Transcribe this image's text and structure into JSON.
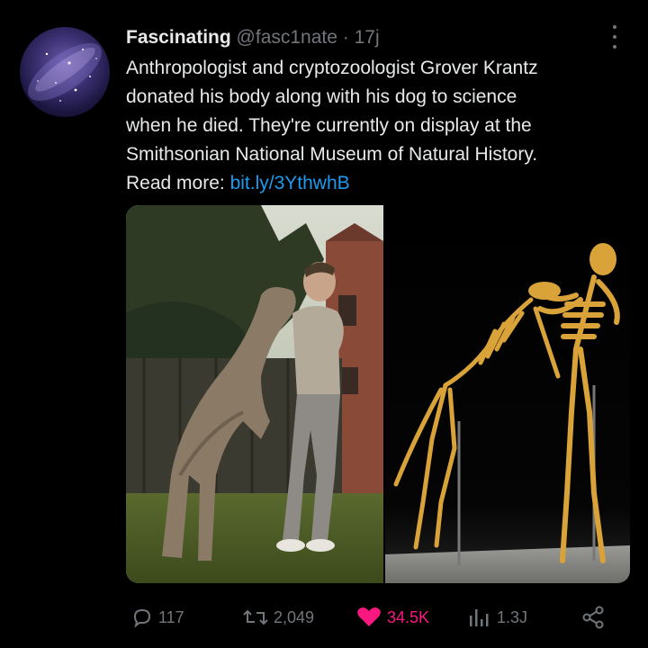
{
  "tweet": {
    "author_name": "Fascinating",
    "author_handle": "@fasc1nate",
    "separator": "·",
    "time": "17j",
    "text_lines": [
      "Anthropologist and cryptozoologist Grover Krantz",
      "donated his body along with his dog to science",
      "when he died. They're currently on display at the",
      "Smithsonian National Museum of Natural History."
    ],
    "read_more_label": "Read more:",
    "link_text": "bit.ly/3YthwhB"
  },
  "actions": {
    "replies": "117",
    "reposts": "2,049",
    "likes": "34.5K",
    "views": "1.3J"
  },
  "icons": {
    "reply": "reply-icon",
    "repost": "repost-icon",
    "like": "heart-icon",
    "views": "views-icon",
    "share": "share-icon",
    "more": "more-icon"
  },
  "colors": {
    "background": "#000000",
    "text": "#e7e9ea",
    "muted": "#71767b",
    "link": "#1d9bf0",
    "like": "#f91880"
  }
}
